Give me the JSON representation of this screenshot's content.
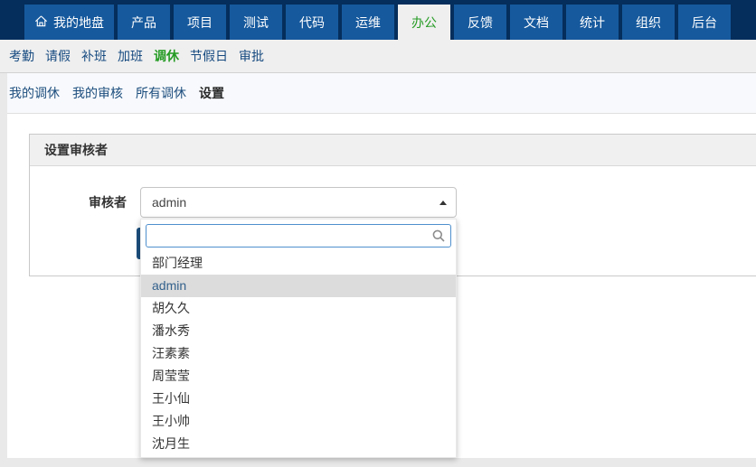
{
  "navbar": {
    "tabs": [
      {
        "label": "我的地盘",
        "icon": "home-icon",
        "active": false
      },
      {
        "label": "产品",
        "active": false
      },
      {
        "label": "项目",
        "active": false
      },
      {
        "label": "测试",
        "active": false
      },
      {
        "label": "代码",
        "active": false
      },
      {
        "label": "运维",
        "active": false
      },
      {
        "label": "办公",
        "active": true
      },
      {
        "label": "反馈",
        "active": false
      },
      {
        "label": "文档",
        "active": false
      },
      {
        "label": "统计",
        "active": false
      },
      {
        "label": "组织",
        "active": false
      },
      {
        "label": "后台",
        "active": false
      }
    ]
  },
  "mainmenu": {
    "items": [
      {
        "label": "考勤",
        "active": false
      },
      {
        "label": "请假",
        "active": false
      },
      {
        "label": "补班",
        "active": false
      },
      {
        "label": "加班",
        "active": false
      },
      {
        "label": "调休",
        "active": true
      },
      {
        "label": "节假日",
        "active": false
      },
      {
        "label": "审批",
        "active": false
      }
    ]
  },
  "featurebar": {
    "items": [
      {
        "label": "我的调休",
        "active": false
      },
      {
        "label": "我的审核",
        "active": false
      },
      {
        "label": "所有调休",
        "active": false
      },
      {
        "label": "设置",
        "active": true
      }
    ]
  },
  "panel": {
    "title": "设置审核者"
  },
  "form": {
    "reviewer_label": "审核者",
    "select_value": "admin",
    "search_value": ""
  },
  "dropdown": {
    "items": [
      {
        "label": "部门经理",
        "selected": false
      },
      {
        "label": "admin",
        "selected": true
      },
      {
        "label": "胡久久",
        "selected": false
      },
      {
        "label": "潘水秀",
        "selected": false
      },
      {
        "label": "汪素素",
        "selected": false
      },
      {
        "label": "周莹莹",
        "selected": false
      },
      {
        "label": "王小仙",
        "selected": false
      },
      {
        "label": "王小帅",
        "selected": false
      },
      {
        "label": "沈月生",
        "selected": false
      }
    ]
  },
  "colors": {
    "navbar_bg": "#052e5c",
    "tab_bg": "#16599d",
    "active_green": "#259b24",
    "link_navy": "#164a80",
    "search_border": "#4f90cd",
    "selected_item_bg": "#dcdcdc",
    "selected_item_text": "#33618c",
    "hidden_button_bg": "#1c4f7e"
  }
}
